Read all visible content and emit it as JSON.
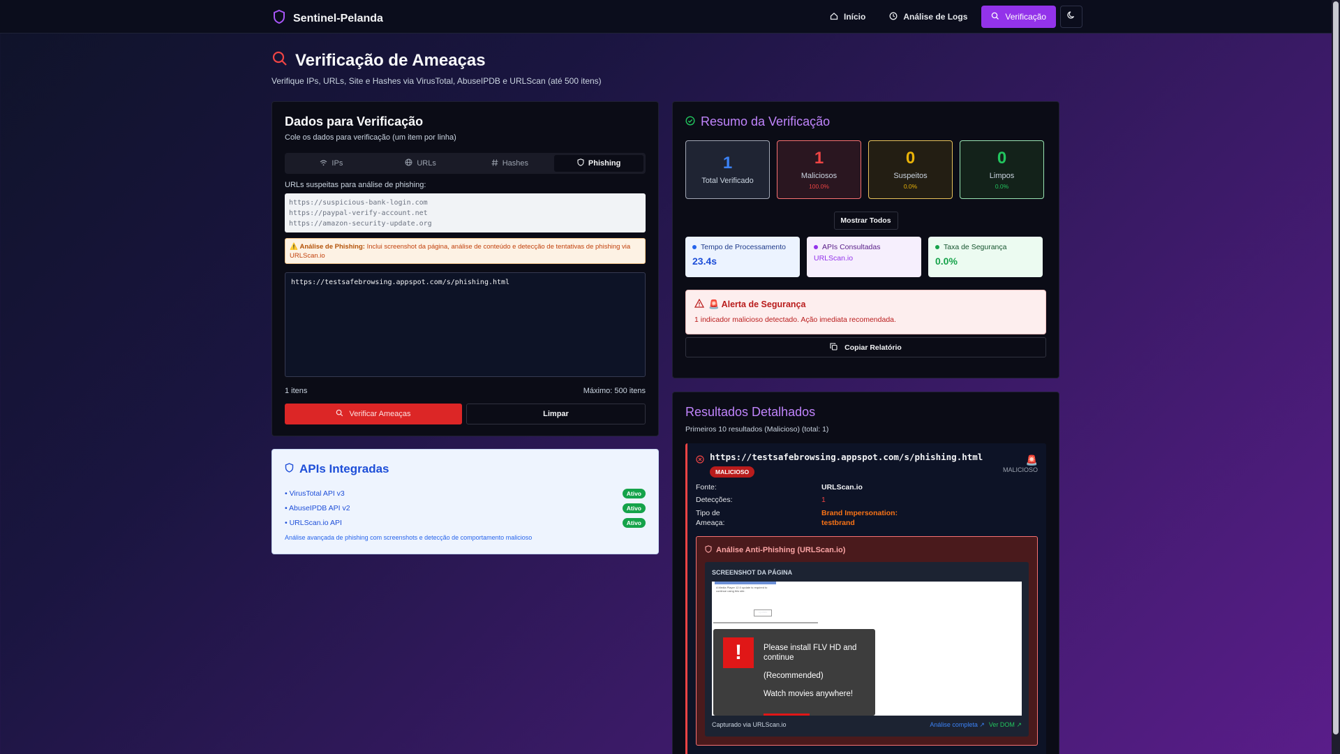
{
  "nav": {
    "brand": "Sentinel-Pelanda",
    "links": [
      {
        "label": "Início",
        "icon": "home-icon"
      },
      {
        "label": "Análise de Logs",
        "icon": "clock-icon"
      },
      {
        "label": "Verificação",
        "icon": "search-icon",
        "active": true
      }
    ],
    "theme_icon": "moon-icon"
  },
  "page": {
    "title": "Verificação de Ameaças",
    "subtitle": "Verifique IPs, URLs, Site e Hashes via VirusTotal, AbuseIPDB e URLScan (até 500 itens)"
  },
  "input": {
    "title": "Dados para Verificação",
    "description": "Cole os dados para verificação (um item por linha)",
    "tabs": [
      {
        "label": "IPs",
        "icon": "wifi-icon"
      },
      {
        "label": "URLs",
        "icon": "globe-icon"
      },
      {
        "label": "Hashes",
        "icon": "hash-icon"
      },
      {
        "label": "Phishing",
        "icon": "shield-icon",
        "active": true
      }
    ],
    "field_label": "URLs suspeitas para análise de phishing:",
    "examples": [
      "https://suspicious-bank-login.com",
      "https://paypal-verify-account.net",
      "https://amazon-security-update.org"
    ],
    "notice_bold": "Análise de Phishing:",
    "notice_text": "Inclui screenshot da página, análise de conteúdo e detecção de tentativas de phishing via URLScan.io",
    "textarea_value": "https://testsafebrowsing.appspot.com/s/phishing.html",
    "count": "1 itens",
    "max": "Máximo: 500 itens",
    "verify_label": "Verificar Ameaças",
    "clear_label": "Limpar"
  },
  "apis": {
    "title": "APIs Integradas",
    "items": [
      {
        "name": "• VirusTotal API v3",
        "status": "Ativo"
      },
      {
        "name": "• AbuseIPDB API v2",
        "status": "Ativo"
      },
      {
        "name": "• URLScan.io API",
        "status": "Ativo"
      }
    ],
    "note": "Análise avançada de phishing com screenshots e detecção de comportamento malicioso"
  },
  "summary": {
    "title": "Resumo da Verificação",
    "stats": [
      {
        "value": "1",
        "label": "Total Verificado",
        "pct": ""
      },
      {
        "value": "1",
        "label": "Maliciosos",
        "pct": "100.0%"
      },
      {
        "value": "0",
        "label": "Suspeitos",
        "pct": "0.0%"
      },
      {
        "value": "0",
        "label": "Limpos",
        "pct": "0.0%"
      }
    ],
    "show_all": "Mostrar Todos",
    "metrics": [
      {
        "title": "Tempo de Processamento",
        "value": "23.4s"
      },
      {
        "title": "APIs Consultadas",
        "value": "URLScan.io"
      },
      {
        "title": "Taxa de Segurança",
        "value": "0.0%"
      }
    ],
    "alert_title": "🚨 Alerta de Segurança",
    "alert_text": "1 indicador malicioso detectado. Ação imediata recomendada.",
    "copy_label": "Copiar Relatório"
  },
  "results": {
    "title": "Resultados Detalhados",
    "subtitle": "Primeiros 10 resultados (Malicioso) (total: 1)",
    "item": {
      "url": "https://testsafebrowsing.appspot.com/s/phishing.html",
      "badge": "MALICIOSO",
      "status_right": "MALICIOSO",
      "fields": [
        {
          "k": "Fonte:",
          "v": "URLScan.io"
        },
        {
          "k": "Detecções:",
          "v": "1"
        },
        {
          "k": "Tipo de Ameaça:",
          "v": "Brand Impersonation: testbrand"
        }
      ],
      "anti_title": "Análise Anti-Phishing (URLScan.io)",
      "screenshot_caption": "SCREENSHOT DA PÁGINA",
      "popup_lines": [
        "Please install FLV HD and continue",
        "(Recommended)",
        "Watch movies anywhere!"
      ],
      "popup_bang": "!",
      "mini_text": "A Media Player 12.0 update is required to continue using this site.",
      "mini_update": "Update",
      "captured": "Capturado via URLScan.io",
      "link_full": "Análise completa",
      "link_dom": "Ver DOM"
    }
  },
  "colors": {
    "accent": "#9333ea",
    "danger": "#dc2626",
    "title_purple": "#c084fc"
  }
}
